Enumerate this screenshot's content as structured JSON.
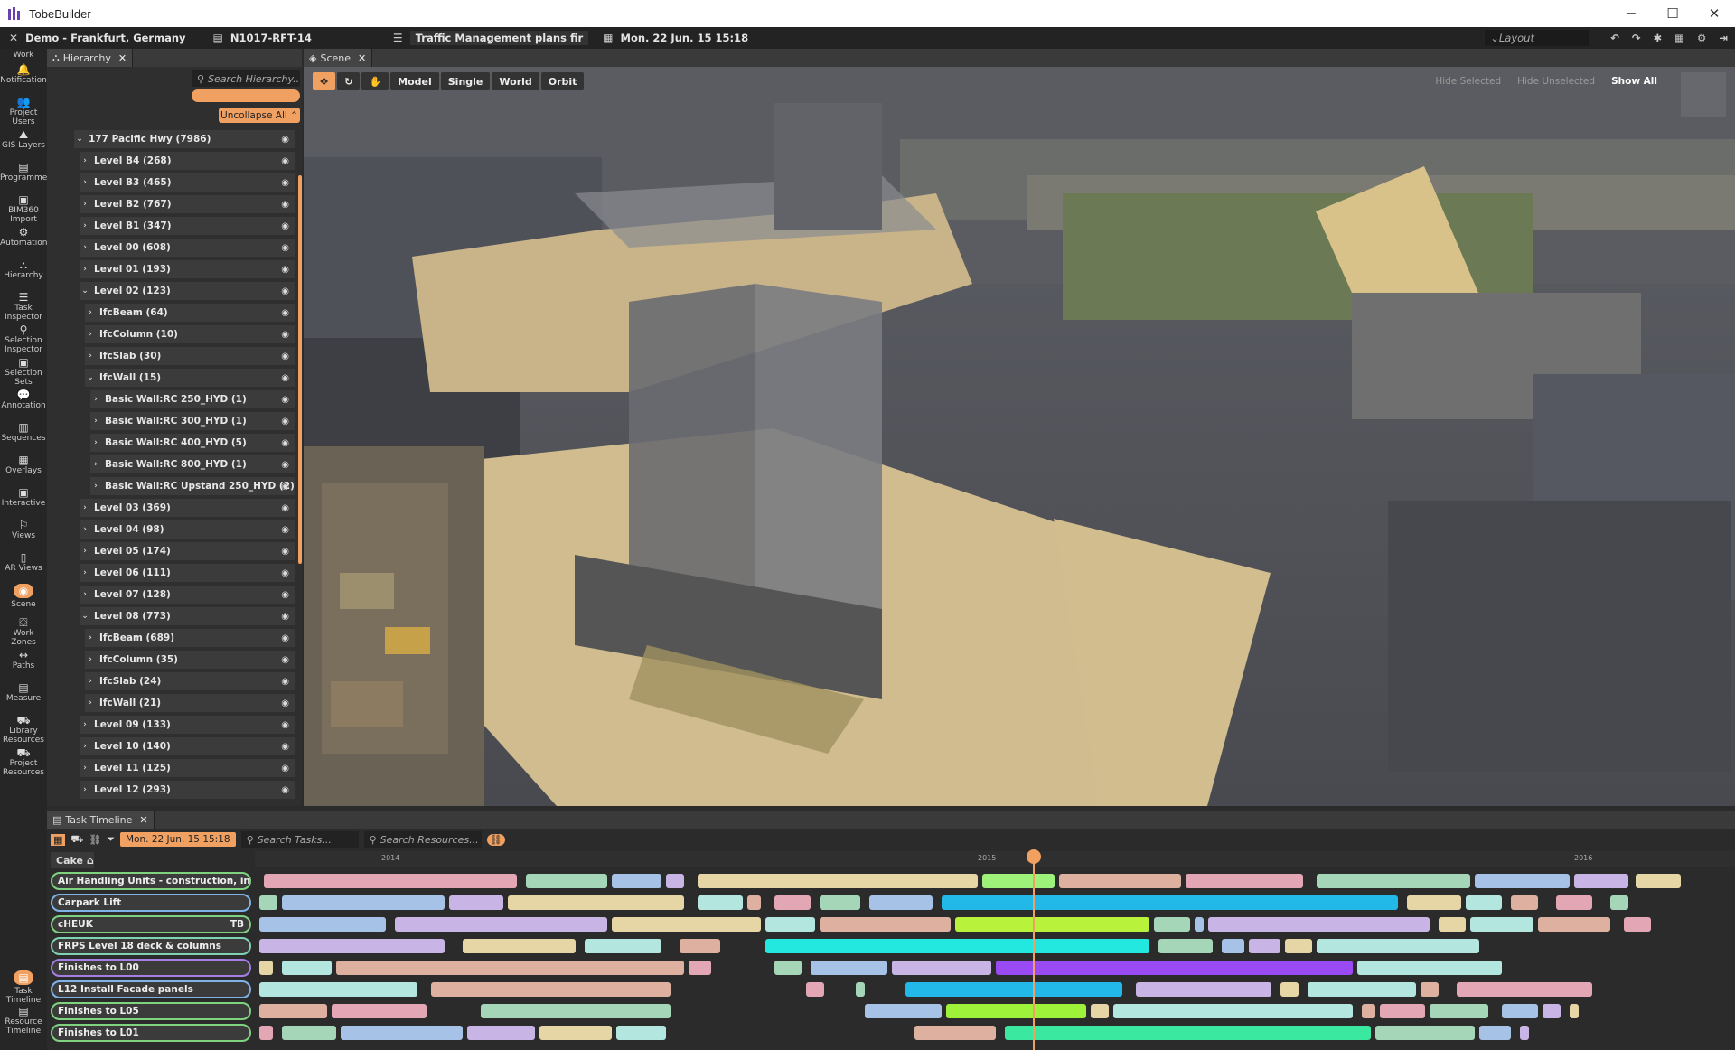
{
  "window": {
    "title": "TobeBuilder"
  },
  "topbar": {
    "project": "Demo - Frankfurt, Germany",
    "file": "N1017-RFT-14",
    "plan": "Traffic Management plans fir",
    "date": "Mon. 22 Jun. 15 15:18",
    "layout_placeholder": "Layout"
  },
  "leftbar": {
    "work_label": "Work",
    "items": [
      "Notification",
      "Project Users",
      "GIS Layers",
      "Programme",
      "BIM360 Import",
      "Automation",
      "Hierarchy",
      "Task Inspector",
      "Selection Inspector",
      "Selection Sets",
      "Annotation",
      "Sequences",
      "Overlays",
      "Interactive",
      "Views",
      "AR Views",
      "Scene",
      "Work Zones",
      "Paths",
      "Measure",
      "Library Resources",
      "Project Resources"
    ],
    "bottom_items": [
      "Task Timeline",
      "Resource Timeline"
    ]
  },
  "hierarchy": {
    "tab": "Hierarchy",
    "search_placeholder": "Search Hierarchy..",
    "uncollapse": "Uncollapse All",
    "rows": [
      {
        "label": "177 Pacific Hwy (7986)",
        "indent": 0,
        "open": true
      },
      {
        "label": "Level B4 (268)",
        "indent": 1
      },
      {
        "label": "Level B3 (465)",
        "indent": 1
      },
      {
        "label": "Level B2 (767)",
        "indent": 1
      },
      {
        "label": "Level B1 (347)",
        "indent": 1
      },
      {
        "label": "Level 00 (608)",
        "indent": 1
      },
      {
        "label": "Level 01 (193)",
        "indent": 1
      },
      {
        "label": "Level 02 (123)",
        "indent": 1,
        "open": true
      },
      {
        "label": "IfcBeam (64)",
        "indent": 2
      },
      {
        "label": "IfcColumn (10)",
        "indent": 2
      },
      {
        "label": "IfcSlab (30)",
        "indent": 2
      },
      {
        "label": "IfcWall (15)",
        "indent": 2,
        "open": true
      },
      {
        "label": "Basic Wall:RC 250_HYD (1)",
        "indent": 3
      },
      {
        "label": "Basic Wall:RC 300_HYD (1)",
        "indent": 3
      },
      {
        "label": "Basic Wall:RC 400_HYD (5)",
        "indent": 3
      },
      {
        "label": "Basic Wall:RC 800_HYD (1)",
        "indent": 3
      },
      {
        "label": "Basic Wall:RC Upstand 250_HYD (2)",
        "indent": 3
      },
      {
        "label": "Level 03 (369)",
        "indent": 1
      },
      {
        "label": "Level 04 (98)",
        "indent": 1
      },
      {
        "label": "Level 05 (174)",
        "indent": 1
      },
      {
        "label": "Level 06 (111)",
        "indent": 1
      },
      {
        "label": "Level 07 (128)",
        "indent": 1
      },
      {
        "label": "Level 08 (773)",
        "indent": 1,
        "open": true
      },
      {
        "label": "IfcBeam (689)",
        "indent": 2
      },
      {
        "label": "IfcColumn (35)",
        "indent": 2
      },
      {
        "label": "IfcSlab (24)",
        "indent": 2
      },
      {
        "label": "IfcWall (21)",
        "indent": 2
      },
      {
        "label": "Level 09 (133)",
        "indent": 1
      },
      {
        "label": "Level 10 (140)",
        "indent": 1
      },
      {
        "label": "Level 11 (125)",
        "indent": 1
      },
      {
        "label": "Level 12 (293)",
        "indent": 1
      }
    ]
  },
  "scene": {
    "tab": "Scene",
    "tools": [
      "Model",
      "Single",
      "World",
      "Orbit"
    ],
    "right": [
      "Hide Selected",
      "Hide Unselected",
      "Show All"
    ]
  },
  "timeline": {
    "tab": "Task Timeline",
    "date": "Mon. 22 Jun. 15 15:18",
    "search_tasks": "Search Tasks...",
    "search_resources": "Search Resources...",
    "cake": "Cake",
    "years": [
      "2014",
      "2015",
      "2016"
    ],
    "tasks": [
      {
        "label": "Air Handling Units - construction, installat",
        "color": "#7fd27f"
      },
      {
        "label": "Carpark Lift",
        "color": "#7fb2e6"
      },
      {
        "label": "cHEUK",
        "color": "#7fd27f",
        "badge": "TB"
      },
      {
        "label": "FRPS Level 18 deck & columns",
        "color": "#7fd2b2"
      },
      {
        "label": "Finishes to L00",
        "color": "#a67fe6"
      },
      {
        "label": "L12 Install Facade panels",
        "color": "#7fb2e6"
      },
      {
        "label": "Finishes to L05",
        "color": "#7fd27f"
      },
      {
        "label": "Finishes to L01",
        "color": "#7fd27f"
      }
    ]
  }
}
